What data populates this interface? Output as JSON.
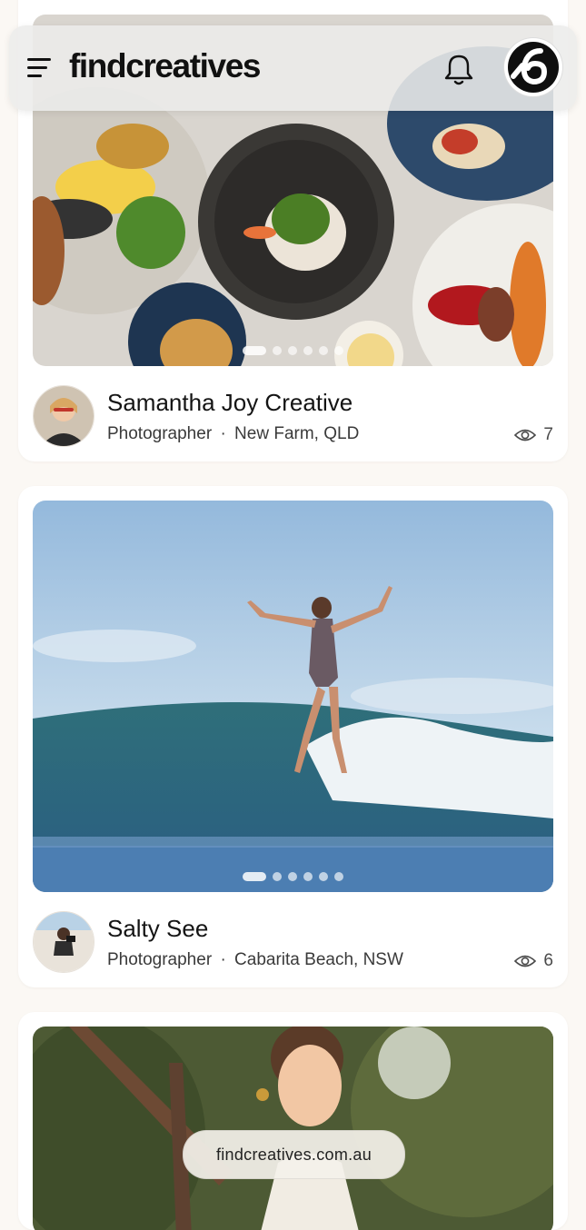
{
  "header": {
    "logo": "findcreatives",
    "menu_icon": "hamburger-menu-icon",
    "notification_icon": "bell-icon",
    "profile_icon": "profile-badge-icon"
  },
  "feed": [
    {
      "name": "Samantha Joy Creative",
      "role": "Photographer",
      "separator": "·",
      "location": "New Farm, QLD",
      "views": "7",
      "image_subject": "plated-food",
      "dots_total": 6,
      "dots_active": 1
    },
    {
      "name": "Salty See",
      "role": "Photographer",
      "separator": "·",
      "location": "Cabarita Beach, NSW",
      "views": "6",
      "image_subject": "surfer",
      "dots_total": 6,
      "dots_active": 1
    },
    {
      "image_subject": "woman-portrait"
    }
  ],
  "footer": {
    "url": "findcreatives.com.au"
  },
  "colors": {
    "background": "#fbf8f4",
    "card": "#ffffff",
    "text": "#141414",
    "secondary_text": "#3a3a3a"
  }
}
